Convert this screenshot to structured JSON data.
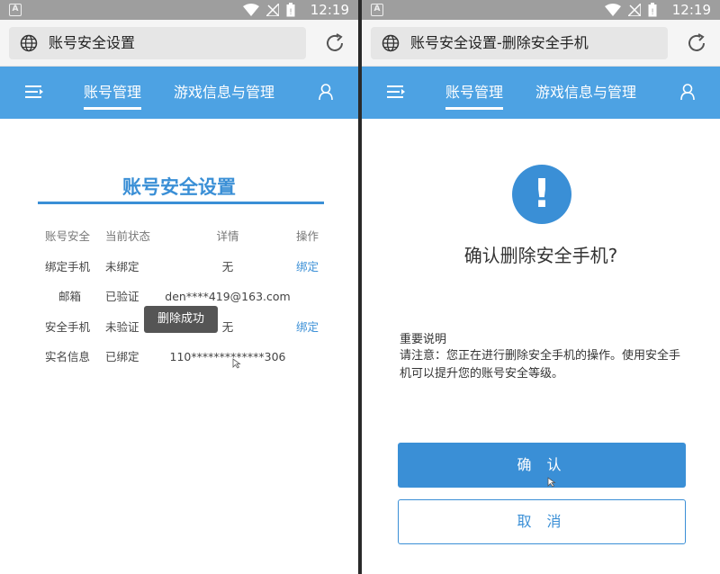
{
  "status_bar": {
    "time": "12:19",
    "app_icon_letter": "A"
  },
  "left": {
    "url_title": "账号安全设置",
    "nav": {
      "tab_account": "账号管理",
      "tab_game": "游戏信息与管理"
    },
    "section_title": "账号安全设置",
    "table": {
      "headers": [
        "账号安全",
        "当前状态",
        "详情",
        "操作"
      ],
      "rows": [
        {
          "item": "绑定手机",
          "status": "未绑定",
          "detail": "无",
          "action": "绑定"
        },
        {
          "item": "邮箱",
          "status": "已验证",
          "detail": "den****419@163.com",
          "action": ""
        },
        {
          "item": "安全手机",
          "status": "未验证",
          "detail": "无",
          "action": "绑定"
        },
        {
          "item": "实名信息",
          "status": "已绑定",
          "detail": "110*************306",
          "action": ""
        }
      ]
    },
    "toast": "删除成功"
  },
  "right": {
    "url_title": "账号安全设置-删除安全手机",
    "nav": {
      "tab_account": "账号管理",
      "tab_game": "游戏信息与管理"
    },
    "alert_symbol": "!",
    "confirm_title": "确认删除安全手机?",
    "note_title": "重要说明",
    "note_body": "请注意：您正在进行删除安全手机的操作。使用安全手机可以提升您的账号安全等级。",
    "confirm_button": "确 认",
    "cancel_button": "取 消"
  },
  "colors": {
    "accent": "#3a8fd6",
    "navbar": "#4da2e3",
    "status_bar": "#9e9e9e"
  }
}
